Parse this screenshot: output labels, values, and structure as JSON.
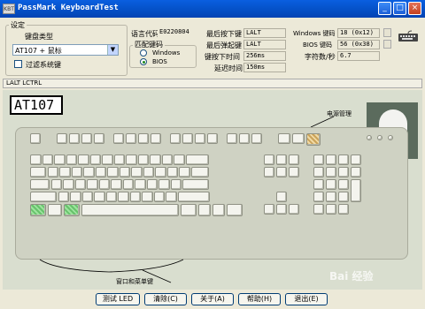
{
  "window": {
    "title": "PassMark KeyboardTest",
    "icon_text": "KBT"
  },
  "settings": {
    "group_label": "设定",
    "keyboard_type_label": "键盘类型",
    "keyboard_type_value": "AT107 + 鼠标",
    "filter_system_keys_label": "过滤系统键",
    "language_code_label": "语言代码",
    "language_code_value": "E0220804",
    "matching_group_label": "匹配键码",
    "match_windows": "Windows",
    "match_bios": "BIOS",
    "last_pressed_label": "最后按下键",
    "last_pressed_value": "LALT",
    "last_released_label": "最后弹起键",
    "last_released_value": "LALT",
    "press_time_label": "键按下时间",
    "press_time_value": "256ms",
    "delay_label": "延迟时间",
    "delay_value": "150ms",
    "windows_keycode_label": "Windows 键码",
    "windows_keycode_value": "18 (0x12)",
    "bios_keycode_label": "BIOS 键码",
    "bios_keycode_value": "56 (0x38)",
    "chars_per_sec_label": "字符数/秒",
    "chars_per_sec_value": "6.7"
  },
  "log_text": "LALT LCTRL",
  "keyboard": {
    "model": "AT107",
    "power_label": "电源管理",
    "window_menu_label": "窗口和菜单键"
  },
  "buttons": {
    "test_led": "测试 LED",
    "clear": "清除(C)",
    "about": "关于(A)",
    "help": "帮助(H)",
    "exit": "退出(E)"
  },
  "watermark": "Bai 经验"
}
